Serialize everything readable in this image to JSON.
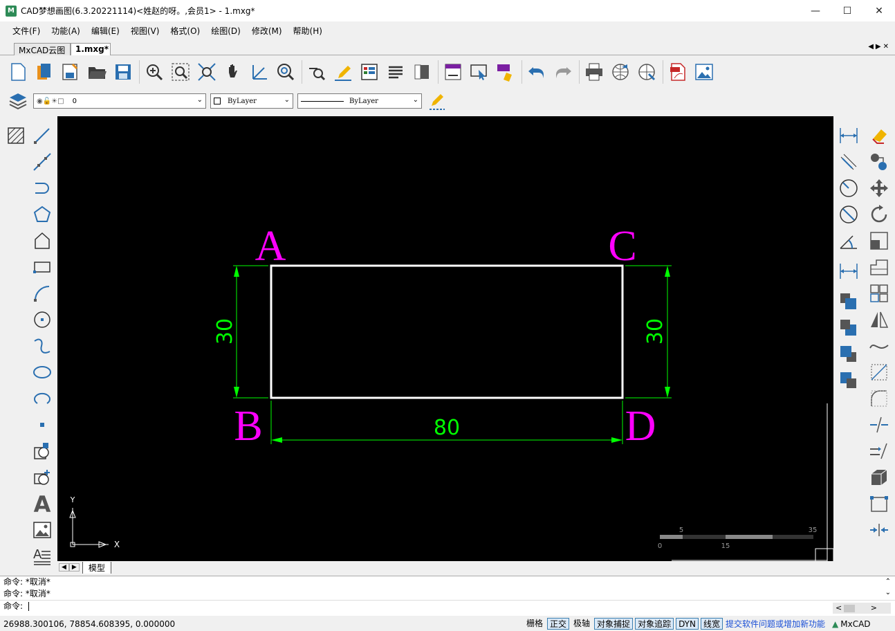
{
  "window": {
    "title": "CAD梦想画图(6.3.20221114)<姓赵的呀。,会员1> - 1.mxg*"
  },
  "menu": [
    "文件(F)",
    "功能(A)",
    "编辑(E)",
    "视图(V)",
    "格式(O)",
    "绘图(D)",
    "修改(M)",
    "帮助(H)"
  ],
  "doc_tabs": [
    {
      "label": "MxCAD云图"
    },
    {
      "label": "1.mxg*"
    }
  ],
  "properties": {
    "layer": "0",
    "color": "ByLayer",
    "linetype": "ByLayer"
  },
  "drawing": {
    "corner_labels": [
      "A",
      "B",
      "C",
      "D"
    ],
    "dim_left": "30",
    "dim_right": "30",
    "dim_bottom": "80",
    "rect_width": 80,
    "rect_height": 30,
    "ucs_y": "Y",
    "ucs_x": "X",
    "scale_ticks_top": [
      "5",
      "35"
    ],
    "scale_ticks_bottom": [
      "0",
      "15"
    ],
    "colors": {
      "labels": "#ff00ff",
      "dims": "#00ff00",
      "rect": "#ffffff",
      "bg": "#000000"
    }
  },
  "layout_tabs": [
    {
      "label": "模型"
    }
  ],
  "command_history": [
    "命令:   *取消*",
    "命令:   *取消*"
  ],
  "command_prompt": "命令:",
  "status": {
    "coords": "26988.300106,  78854.608395,  0.000000",
    "toggles": [
      {
        "label": "栅格",
        "on": false
      },
      {
        "label": "正交",
        "on": true
      },
      {
        "label": "极轴",
        "on": false
      },
      {
        "label": "对象捕捉",
        "on": true
      },
      {
        "label": "对象追踪",
        "on": true
      },
      {
        "label": "DYN",
        "on": true
      },
      {
        "label": "线宽",
        "on": true
      }
    ],
    "feedback_link": "提交软件问题或增加新功能",
    "brand": "MxCAD"
  }
}
